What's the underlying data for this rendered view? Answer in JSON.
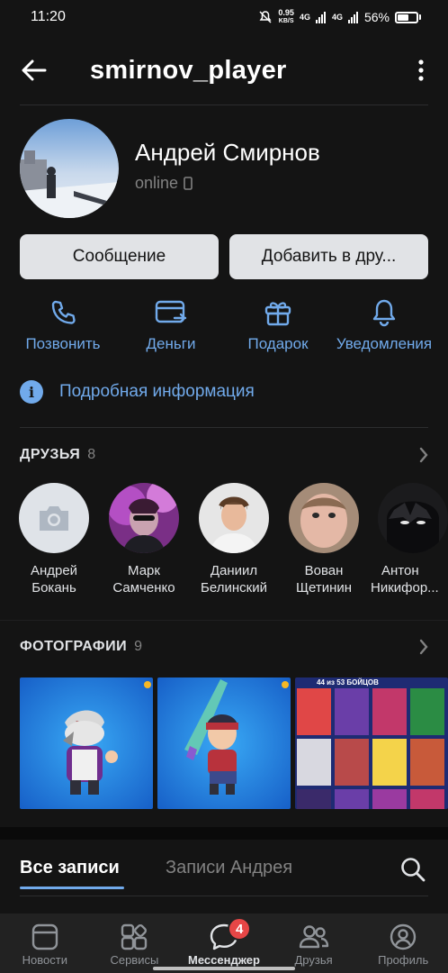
{
  "status_bar": {
    "time": "11:20",
    "net_speed_value": "0.95",
    "net_speed_unit": "KB/S",
    "network_1": "4G",
    "network_2": "4G",
    "battery": "56%"
  },
  "header": {
    "title": "smirnov_player"
  },
  "profile": {
    "name": "Андрей Смирнов",
    "status": "online"
  },
  "buttons": {
    "message": "Сообщение",
    "add_friend": "Добавить в дру..."
  },
  "actions": [
    {
      "label": "Позвонить",
      "icon": "phone-icon"
    },
    {
      "label": "Деньги",
      "icon": "money-transfer-icon"
    },
    {
      "label": "Подарок",
      "icon": "gift-icon"
    },
    {
      "label": "Уведомления",
      "icon": "bell-icon"
    }
  ],
  "info": {
    "label": "Подробная информация"
  },
  "friends": {
    "title": "ДРУЗЬЯ",
    "count": "8",
    "items": [
      {
        "line1": "Андрей",
        "line2": "Бокань"
      },
      {
        "line1": "Марк",
        "line2": "Самченко"
      },
      {
        "line1": "Даниил",
        "line2": "Белинский"
      },
      {
        "line1": "Вован",
        "line2": "Щетинин"
      },
      {
        "line1": "Антон",
        "line2": "Никифор..."
      }
    ]
  },
  "photos": {
    "title": "ФОТОГРАФИИ",
    "count": "9",
    "third_caption": "44 из 53 БОЙЦОВ"
  },
  "wall_tabs": {
    "all": "Все записи",
    "own": "Записи Андрея"
  },
  "bottom_nav": [
    {
      "label": "Новости",
      "icon": "news-icon"
    },
    {
      "label": "Сервисы",
      "icon": "services-icon"
    },
    {
      "label": "Мессенджер",
      "icon": "messenger-icon",
      "badge": "4"
    },
    {
      "label": "Друзья",
      "icon": "friends-icon"
    },
    {
      "label": "Профиль",
      "icon": "profile-icon"
    }
  ],
  "colors": {
    "accent": "#71aaeb",
    "background": "#141414",
    "badge": "#e64646"
  }
}
